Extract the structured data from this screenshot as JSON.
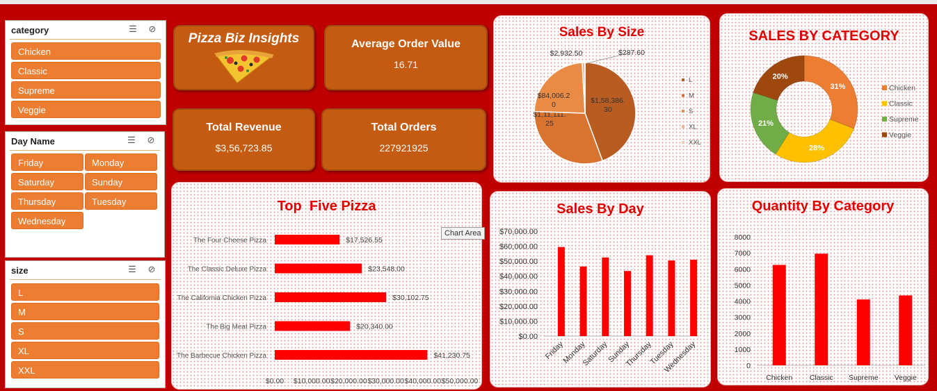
{
  "slicers": {
    "category": {
      "title": "category",
      "items": [
        "Chicken",
        "Classic",
        "Supreme",
        "Veggie"
      ]
    },
    "day": {
      "title": "Day Name",
      "items": [
        "Friday",
        "Monday",
        "Saturday",
        "Sunday",
        "Thursday",
        "Tuesday",
        "Wednesday"
      ]
    },
    "size": {
      "title": "size",
      "items": [
        "L",
        "M",
        "S",
        "XL",
        "XXL"
      ]
    }
  },
  "kpis": {
    "brand": "Pizza Biz Insights",
    "aov_title": "Average Order Value",
    "aov_value": "16.71",
    "revenue_title": "Total Revenue",
    "revenue_value": "$3,56,723.85",
    "orders_title": "Total Orders",
    "orders_value": "227921925"
  },
  "tooltip": "Chart Area",
  "colors": {
    "accent": "#ff0000",
    "title": "#e00000",
    "slicer": "#ed7d31",
    "kpi": "#c55a11",
    "background": "#c00000"
  },
  "chart_data": [
    {
      "id": "top5",
      "type": "bar",
      "orientation": "horizontal",
      "title": "Top  Five Pizza",
      "categories": [
        "The Four Cheese Pizza",
        "The Classic Deluxe Pizza",
        "The California Chicken Pizza",
        "The Big Meat Pizza",
        "The Barbecue Chicken Pizza"
      ],
      "values": [
        17526.55,
        23548.0,
        30102.75,
        20340.0,
        41230.75
      ],
      "value_labels": [
        "$17,526.55",
        "$23,548.00",
        "$30,102.75",
        "$20,340.00",
        "$41,230.75"
      ],
      "xlim": [
        0,
        50000
      ],
      "tick_labels": [
        "$0.00",
        "$10,000.00",
        "$20,000.00",
        "$30,000.00",
        "$40,000.00",
        "$50,000.00"
      ],
      "color": "#ff0000"
    },
    {
      "id": "size",
      "type": "pie",
      "title": "Sales By Size",
      "categories": [
        "L",
        "M",
        "S",
        "XL",
        "XXL"
      ],
      "values": [
        158386.3,
        111111.25,
        84006.2,
        2932.5,
        287.6
      ],
      "value_labels": [
        "$1,58,386.30",
        "$1,11,111.25",
        "$84,006.20",
        "$2,932.50",
        "$287.60"
      ],
      "colors": [
        "#b85c21",
        "#d97330",
        "#e98a45",
        "#f2b08a",
        "#f6cbb5"
      ],
      "legend": "right"
    },
    {
      "id": "category",
      "type": "pie",
      "subtype": "donut",
      "title": "SALES BY CATEGORY",
      "categories": [
        "Chicken",
        "Classic",
        "Supreme",
        "Veggie"
      ],
      "values": [
        31,
        28,
        21,
        20
      ],
      "value_labels": [
        "31%",
        "28%",
        "21%",
        "20%"
      ],
      "colors": [
        "#ed7d31",
        "#ffc000",
        "#70ad47",
        "#9e480e"
      ],
      "legend": "right"
    },
    {
      "id": "day",
      "type": "bar",
      "title": "Sales By Day",
      "categories": [
        "Friday",
        "Monday",
        "Saturday",
        "Sunday",
        "Thursday",
        "Tuesday",
        "Wednesday"
      ],
      "values": [
        59500,
        46500,
        52500,
        43500,
        54000,
        50500,
        51000
      ],
      "ylim": [
        0,
        70000
      ],
      "tick_labels": [
        "$0.00",
        "$10,000.00",
        "$20,000.00",
        "$30,000.00",
        "$40,000.00",
        "$50,000.00",
        "$60,000.00",
        "$70,000.00"
      ],
      "color": "#ff0000"
    },
    {
      "id": "qty",
      "type": "bar",
      "title": "Quantity By Category",
      "categories": [
        "Chicken",
        "Classic",
        "Supreme",
        "Veggie"
      ],
      "values": [
        6250,
        6950,
        4100,
        4350
      ],
      "ylim": [
        0,
        8000
      ],
      "tick_labels": [
        "0",
        "1000",
        "2000",
        "3000",
        "4000",
        "5000",
        "6000",
        "7000",
        "8000"
      ],
      "color": "#ff0000"
    }
  ]
}
